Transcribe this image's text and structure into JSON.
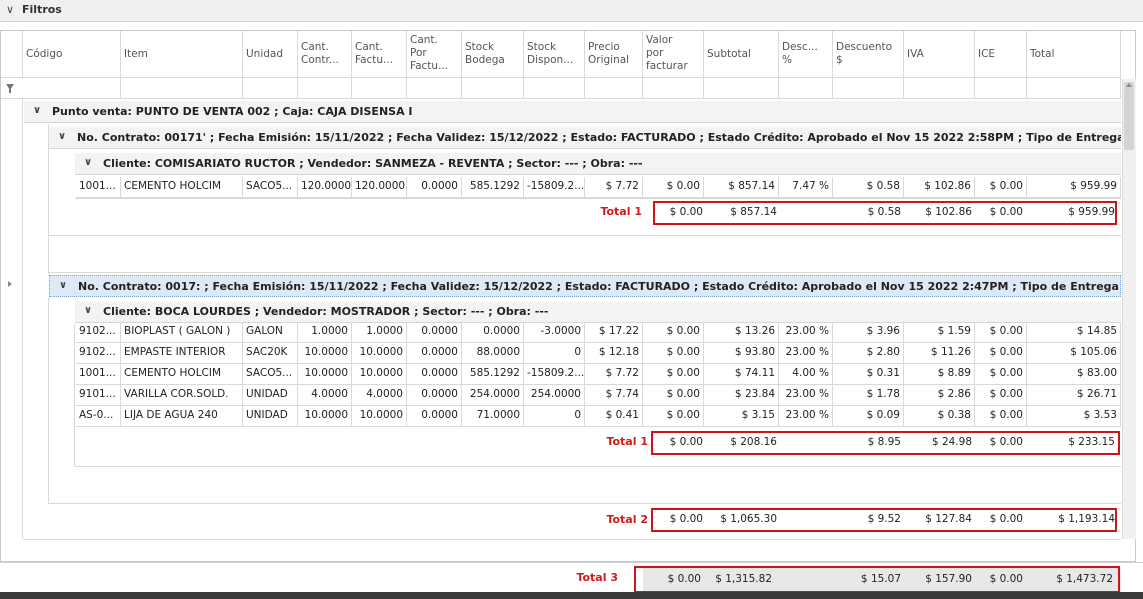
{
  "filters": {
    "label": "Filtros"
  },
  "columns": [
    {
      "key": "codigo",
      "label": "Código"
    },
    {
      "key": "item",
      "label": "Item"
    },
    {
      "key": "unidad",
      "label": "Unidad"
    },
    {
      "key": "cant_contr",
      "label": "Cant.\nContr..."
    },
    {
      "key": "cant_fact",
      "label": "Cant.\nFactu..."
    },
    {
      "key": "cant_por",
      "label": "Cant.\nPor\nFactu..."
    },
    {
      "key": "stock_bod",
      "label": "Stock\nBodega"
    },
    {
      "key": "stock_disp",
      "label": "Stock\nDispon..."
    },
    {
      "key": "precio",
      "label": "Precio\nOriginal"
    },
    {
      "key": "valor",
      "label": "Valor\npor\nfacturar"
    },
    {
      "key": "subtotal",
      "label": "Subtotal"
    },
    {
      "key": "desc_pct",
      "label": "Desc...\n%"
    },
    {
      "key": "desc_amt",
      "label": "Descuento\n$"
    },
    {
      "key": "iva",
      "label": "IVA"
    },
    {
      "key": "ice",
      "label": "ICE"
    },
    {
      "key": "total",
      "label": "Total"
    }
  ],
  "groups": {
    "punto_venta": "Punto venta: PUNTO DE VENTA 002 ; Caja: CAJA DISENSA I",
    "contrato1": "No. Contrato: 00171'      ; Fecha Emisión: 15/11/2022 ; Fecha Validez: 15/12/2022 ; Estado: FACTURADO ; Estado Crédito: Aprobado el Nov 15 2022  2:58PM ; Tipo de Entrega: Retiro en Local",
    "cliente1": "Cliente: COMISARIATO RUCTOR ; Vendedor: SANMEZA - REVENTA ; Sector: --- ; Obra: ---",
    "contrato2": "No. Contrato: 0017:       ; Fecha Emisión: 15/11/2022 ; Fecha Validez: 15/12/2022 ; Estado: FACTURADO ; Estado Crédito: Aprobado el Nov 15 2022  2:47PM ; Tipo de Entrega: Retiro en Local",
    "cliente2": "Cliente: BOCA LOURDES ; Vendedor: MOSTRADOR ; Sector: --- ; Obra: ---"
  },
  "rows1": [
    [
      "1001...",
      "CEMENTO HOLCIM",
      "SACO5...",
      "120.0000",
      "120.0000",
      "0.0000",
      "585.1292",
      "-15809.2...",
      "$ 7.72",
      "$ 0.00",
      "$ 857.14",
      "7.47 %",
      "$ 0.58",
      "$ 102.86",
      "$ 0.00",
      "$ 959.99"
    ]
  ],
  "rows2": [
    [
      "9102...",
      "BIOPLAST ( GALON )",
      "GALON",
      "1.0000",
      "1.0000",
      "0.0000",
      "0.0000",
      "-3.0000",
      "$ 17.22",
      "$ 0.00",
      "$ 13.26",
      "23.00 %",
      "$ 3.96",
      "$ 1.59",
      "$ 0.00",
      "$ 14.85"
    ],
    [
      "9102...",
      "EMPASTE INTERIOR",
      "SAC20K",
      "10.0000",
      "10.0000",
      "0.0000",
      "88.0000",
      "0",
      "$ 12.18",
      "$ 0.00",
      "$ 93.80",
      "23.00 %",
      "$ 2.80",
      "$ 11.26",
      "$ 0.00",
      "$ 105.06"
    ],
    [
      "1001...",
      "CEMENTO HOLCIM",
      "SACO5...",
      "10.0000",
      "10.0000",
      "0.0000",
      "585.1292",
      "-15809.2...",
      "$ 7.72",
      "$ 0.00",
      "$ 74.11",
      "4.00 %",
      "$ 0.31",
      "$ 8.89",
      "$ 0.00",
      "$ 83.00"
    ],
    [
      "9101...",
      "VARILLA COR.SOLD.",
      "UNIDAD",
      "4.0000",
      "4.0000",
      "0.0000",
      "254.0000",
      "254.0000",
      "$ 7.74",
      "$ 0.00",
      "$ 23.84",
      "23.00 %",
      "$ 1.78",
      "$ 2.86",
      "$ 0.00",
      "$ 26.71"
    ],
    [
      "AS-0...",
      "LIJA DE AGUA  240",
      "UNIDAD",
      "10.0000",
      "10.0000",
      "0.0000",
      "71.0000",
      "0",
      "$ 0.41",
      "$ 0.00",
      "$ 3.15",
      "23.00 %",
      "$ 0.09",
      "$ 0.38",
      "$ 0.00",
      "$ 3.53"
    ]
  ],
  "totals": {
    "t1a": {
      "label": "Total 1",
      "valor": "$ 0.00",
      "subtotal": "$ 857.14",
      "desc": "$ 0.58",
      "iva": "$ 102.86",
      "ice": "$ 0.00",
      "total": "$ 959.99"
    },
    "t1b": {
      "label": "Total 1",
      "valor": "$ 0.00",
      "subtotal": "$ 208.16",
      "desc": "$ 8.95",
      "iva": "$ 24.98",
      "ice": "$ 0.00",
      "total": "$ 233.15"
    },
    "t2": {
      "label": "Total 2",
      "valor": "$ 0.00",
      "subtotal": "$ 1,065.30",
      "desc": "$ 9.52",
      "iva": "$ 127.84",
      "ice": "$ 0.00",
      "total": "$ 1,193.14"
    },
    "t3": {
      "label": "Total 3",
      "valor": "$ 0.00",
      "subtotal": "$ 1,315.82",
      "desc": "$ 15.07",
      "iva": "$ 157.90",
      "ice": "$ 0.00",
      "total": "$ 1,473.72"
    }
  },
  "colors": {
    "accent_red": "#d0141c",
    "selection": "#dfe9f5"
  }
}
